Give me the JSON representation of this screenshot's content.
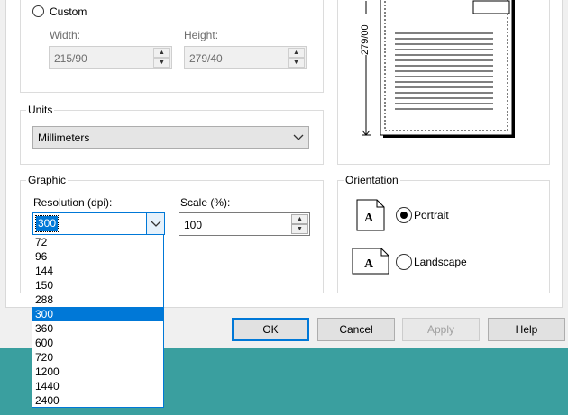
{
  "size": {
    "custom_label": "Custom",
    "width_label": "Width:",
    "width_value": "215/90",
    "height_label": "Height:",
    "height_value": "279/40"
  },
  "preview": {
    "dimension_label": "279/00"
  },
  "units": {
    "title": "Units",
    "selected": "Millimeters"
  },
  "graphic": {
    "title": "Graphic",
    "resolution_label": "Resolution (dpi):",
    "resolution_value": "300",
    "scale_label": "Scale (%):",
    "scale_value": "100",
    "resolution_options": [
      "72",
      "96",
      "144",
      "150",
      "288",
      "300",
      "360",
      "600",
      "720",
      "1200",
      "1440",
      "2400"
    ],
    "selected_index": 5
  },
  "orientation": {
    "title": "Orientation",
    "portrait_label": "Portrait",
    "landscape_label": "Landscape",
    "icon_letter": "A",
    "selected": "portrait"
  },
  "buttons": {
    "ok": "OK",
    "cancel": "Cancel",
    "apply": "Apply",
    "help": "Help"
  },
  "colors": {
    "accent": "#0078d7",
    "taskbar": "#3a9f9f"
  }
}
